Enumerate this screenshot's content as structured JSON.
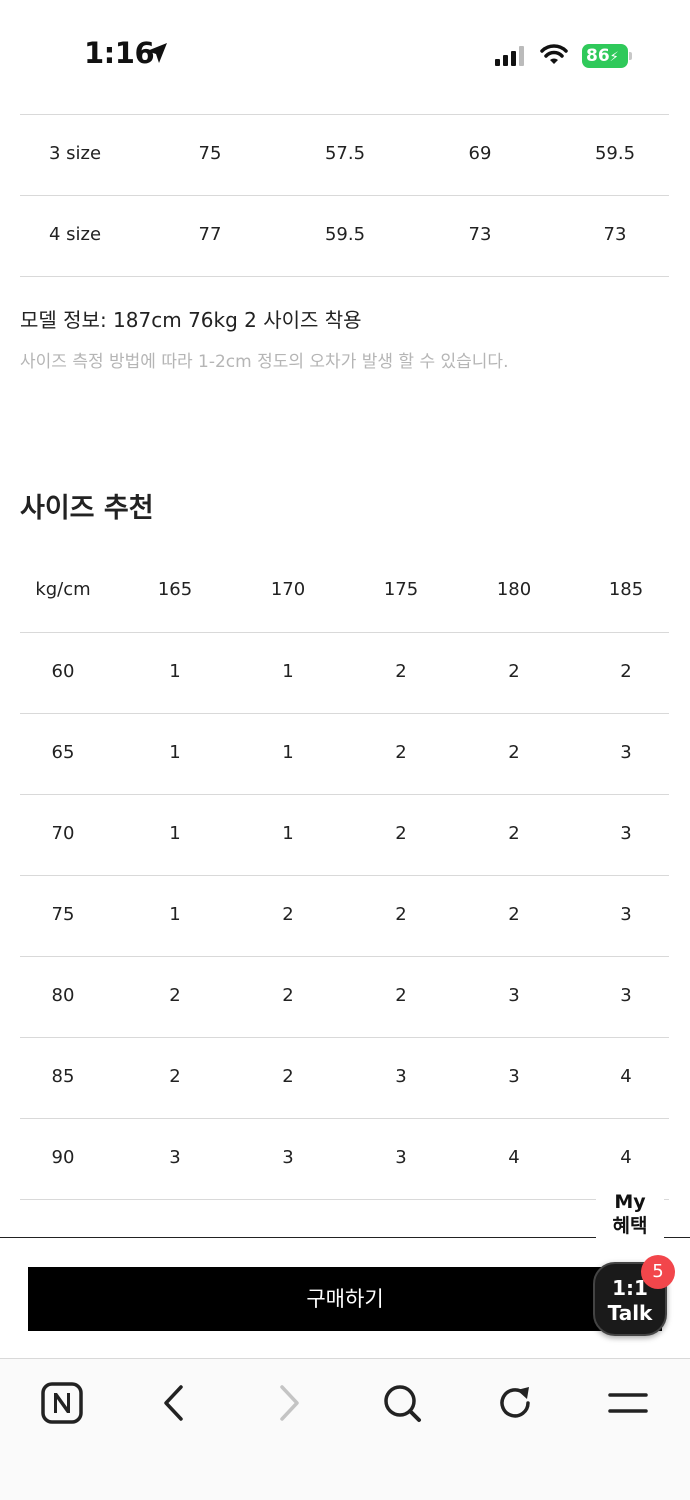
{
  "status_bar": {
    "time": "1:16",
    "battery": "86"
  },
  "size_table": {
    "rows": [
      {
        "size": "3 size",
        "values": [
          "75",
          "57.5",
          "69",
          "59.5"
        ]
      },
      {
        "size": "4 size",
        "values": [
          "77",
          "59.5",
          "73",
          "73"
        ]
      }
    ]
  },
  "model_info": "모델 정보: 187cm 76kg 2 사이즈 착용",
  "measure_note": "사이즈 측정 방법에 따라 1-2cm 정도의 오차가 발생 할 수 있습니다.",
  "recommend": {
    "title": "사이즈 추천",
    "corner": "kg/cm",
    "heights": [
      "165",
      "170",
      "175",
      "180",
      "185"
    ],
    "rows": [
      {
        "weight": "60",
        "values": [
          "1",
          "1",
          "2",
          "2",
          "2"
        ]
      },
      {
        "weight": "65",
        "values": [
          "1",
          "1",
          "2",
          "2",
          "3"
        ]
      },
      {
        "weight": "70",
        "values": [
          "1",
          "1",
          "2",
          "2",
          "3"
        ]
      },
      {
        "weight": "75",
        "values": [
          "1",
          "2",
          "2",
          "2",
          "3"
        ]
      },
      {
        "weight": "80",
        "values": [
          "2",
          "2",
          "2",
          "3",
          "3"
        ]
      },
      {
        "weight": "85",
        "values": [
          "2",
          "2",
          "3",
          "3",
          "4"
        ]
      },
      {
        "weight": "90",
        "values": [
          "3",
          "3",
          "3",
          "4",
          "4"
        ]
      }
    ]
  },
  "my_benefit": {
    "line1": "My",
    "line2": "혜택"
  },
  "buy_button": "구매하기",
  "talk": {
    "line1": "1:1",
    "line2": "Talk",
    "badge": "5"
  },
  "toolbar_icons": [
    "naver-home-icon",
    "back-icon",
    "forward-icon",
    "search-icon",
    "refresh-icon",
    "menu-icon"
  ]
}
